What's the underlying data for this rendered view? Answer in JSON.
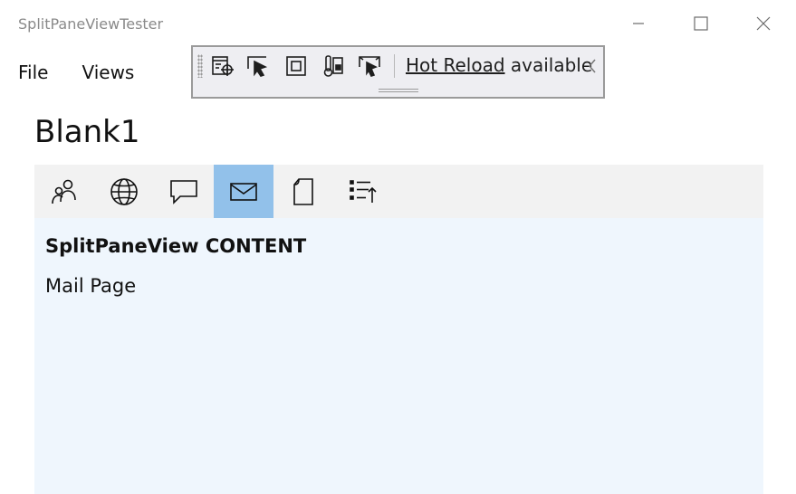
{
  "window": {
    "title": "SplitPaneViewTester",
    "controls": [
      "minimize-icon",
      "maximize-icon",
      "close-icon"
    ]
  },
  "menu": {
    "items": [
      {
        "label": "File"
      },
      {
        "label": "Views"
      }
    ]
  },
  "xaml_toolbar": {
    "tools": [
      "live-visual-tree-icon",
      "select-element-icon",
      "display-layout-adorners-icon",
      "track-focus-icon",
      "show-binding-failures-icon"
    ],
    "hot_reload_link": "Hot Reload",
    "hot_reload_status": "available",
    "collapse_icon": "chevron-left-icon"
  },
  "page": {
    "title": "Blank1"
  },
  "nav": {
    "items": [
      {
        "icon": "people-icon",
        "selected": false
      },
      {
        "icon": "globe-icon",
        "selected": false
      },
      {
        "icon": "message-icon",
        "selected": false
      },
      {
        "icon": "mail-icon",
        "selected": true
      },
      {
        "icon": "page-icon",
        "selected": false
      },
      {
        "icon": "list-sort-icon",
        "selected": false
      }
    ],
    "selected_color": "#92c1ea",
    "strip_color": "#f2f2f2"
  },
  "content": {
    "heading": "SplitPaneView CONTENT",
    "page_label": "Mail Page",
    "background": "#eff6fd"
  }
}
